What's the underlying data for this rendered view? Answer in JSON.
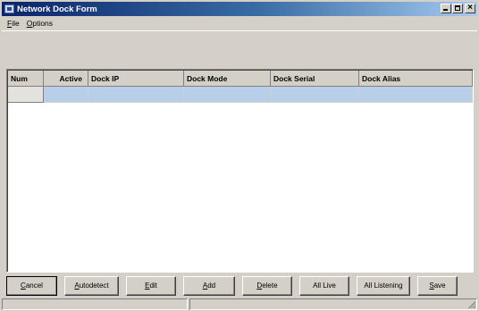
{
  "window": {
    "title": "Network Dock Form"
  },
  "menu": {
    "file_prefix": "",
    "file_underline": "F",
    "file_rest": "ile",
    "options_underline": "O",
    "options_rest": "ptions"
  },
  "grid": {
    "columns": [
      "Num",
      "Active",
      "Dock IP",
      "Dock Mode",
      "Dock Serial",
      "Dock Alias"
    ],
    "rows": [
      {
        "num": "",
        "active": "",
        "dock_ip": "",
        "dock_mode": "",
        "dock_serial": "",
        "dock_alias": ""
      }
    ]
  },
  "buttons": {
    "cancel_u": "C",
    "cancel_rest": "ancel",
    "autodetect_u": "A",
    "autodetect_rest": "utodetect",
    "edit_u": "E",
    "edit_rest": "dit",
    "add_u": "A",
    "add_rest": "dd",
    "delete_u": "D",
    "delete_rest": "elete",
    "all_live": "All Live",
    "all_listening": "All Listening",
    "save_u": "S",
    "save_rest": "ave"
  },
  "colors": {
    "titlebar_start": "#0a246a",
    "titlebar_end": "#a6caf0",
    "selected_row": "#b8cfea",
    "window_face": "#d4d0c8"
  },
  "icons": {
    "app": "network-dock-app-icon",
    "minimize": "minimize-icon",
    "maximize": "maximize-icon",
    "close": "close-icon",
    "grip": "size-grip-icon"
  }
}
